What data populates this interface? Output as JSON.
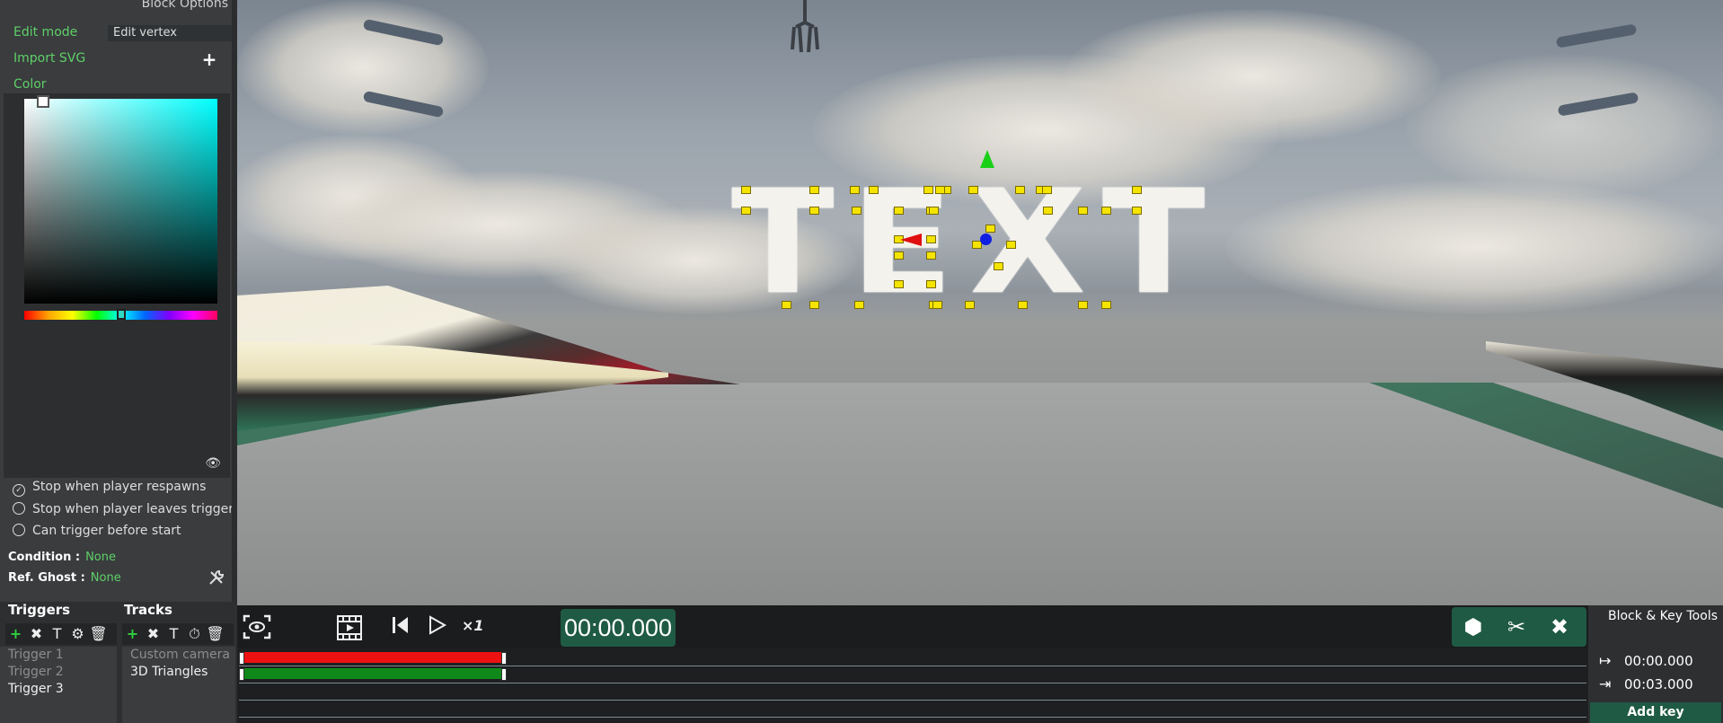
{
  "left_panel": {
    "title": "Block Options",
    "edit_mode_label": "Edit mode",
    "edit_mode_value": "Edit vertex",
    "import_svg_label": "Import SVG",
    "import_svg_plus": "+",
    "color_label": "Color",
    "color_value": "#00ffff",
    "hue_position_fraction": 0.5,
    "eye_icon": "👁",
    "options": [
      {
        "label": "Stop when player respawns",
        "checked": true
      },
      {
        "label": "Stop when player leaves trigger",
        "checked": false
      },
      {
        "label": "Can trigger before start",
        "checked": false
      }
    ],
    "condition_label": "Condition :",
    "condition_value": "None",
    "ref_ghost_label": "Ref. Ghost :",
    "ref_ghost_value": "None"
  },
  "viewport": {
    "text": "TEXT"
  },
  "triggers": {
    "title": "Triggers",
    "items": [
      "Trigger 1",
      "Trigger 2",
      "Trigger 3"
    ],
    "tool_icons": [
      "+",
      "✖",
      "T",
      "⚙",
      "🗑"
    ]
  },
  "tracks": {
    "title": "Tracks",
    "items": [
      "Custom camera",
      "3D Triangles"
    ],
    "tool_icons": [
      "+",
      "✖",
      "T",
      "⏱",
      "🗑"
    ]
  },
  "timeline": {
    "speed": "×1",
    "time": "00:00.000",
    "track_bars": [
      {
        "color": "#ee1111"
      },
      {
        "color": "#0f8a1a"
      }
    ]
  },
  "block_key_tools": {
    "title": "Block & Key Tools",
    "start_time": "00:00.000",
    "end_time": "00:03.000",
    "add_key": "Add key"
  }
}
